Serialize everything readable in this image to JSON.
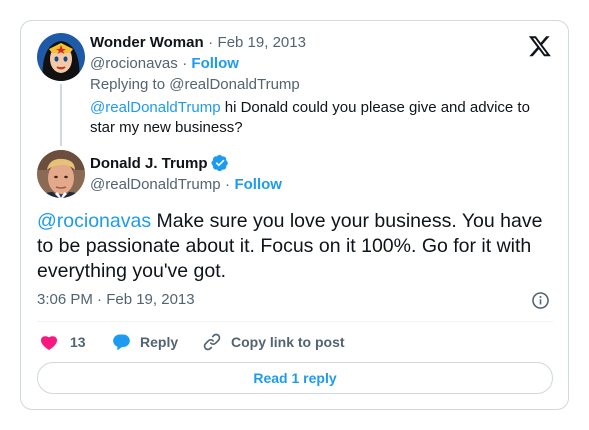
{
  "reply_tweet": {
    "author_name": "Wonder Woman",
    "separator": "·",
    "date": "Feb 19, 2013",
    "handle": "@rocionavas",
    "follow_label": "Follow",
    "replying_prefix": "Replying to",
    "replying_handle": "@realDonaldTrump",
    "mention": "@realDonaldTrump",
    "text": " hi Donald could you please give and advice to star my new business?"
  },
  "main_tweet": {
    "author_name": "Donald J. Trump",
    "handle": "@realDonaldTrump",
    "separator": "·",
    "follow_label": "Follow",
    "mention": "@rocionavas",
    "text": "  Make sure you love your business. You have to be passionate about it. Focus on it 100%. Go for it with everything you've got.",
    "time": "3:06 PM · Feb 19, 2013"
  },
  "actions": {
    "like_count": "13",
    "reply_label": "Reply",
    "copy_label": "Copy link to post"
  },
  "read_replies_label": "Read 1 reply",
  "colors": {
    "accent": "#1d9bf0",
    "like": "#f91880",
    "verified": "#1d9bf0",
    "text": "#0f1419",
    "muted": "#536471"
  },
  "icons": [
    "x-logo-icon",
    "verified-badge-icon",
    "info-icon",
    "heart-icon",
    "reply-bubble-icon",
    "link-icon"
  ]
}
